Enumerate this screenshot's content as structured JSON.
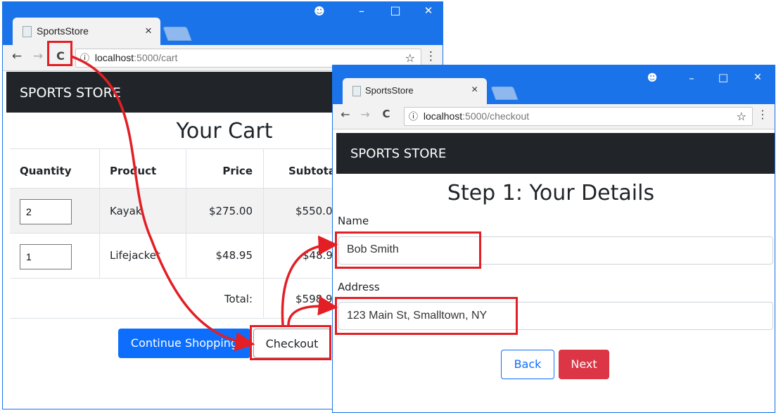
{
  "cart_window": {
    "tab_title": "SportsStore",
    "tab_close": "×",
    "url_host": "localhost",
    "url_path": ":5000/cart",
    "info_symbol": "ⓘ",
    "star": "☆",
    "menu": "⋮",
    "back": "←",
    "forward": "→",
    "reload": "C",
    "brand": "SPORTS STORE",
    "heading": "Your Cart",
    "table": {
      "headers": [
        "Quantity",
        "Product",
        "Price",
        "Subtotal"
      ],
      "rows": [
        {
          "quantity": "2",
          "product": "Kayak",
          "price": "$275.00",
          "subtotal": "$550.00"
        },
        {
          "quantity": "1",
          "product": "Lifejacket",
          "price": "$48.95",
          "subtotal": "$48.95"
        }
      ],
      "total_label": "Total:",
      "total_value": "$598.95"
    },
    "continue_button": "Continue Shopping",
    "checkout_button": "Checkout",
    "window_controls": {
      "account": "☻",
      "minimize": "–",
      "maximize": "□",
      "close": "✕"
    }
  },
  "checkout_window": {
    "tab_title": "SportsStore",
    "tab_close": "×",
    "url_host": "localhost",
    "url_path": ":5000/checkout",
    "info_symbol": "ⓘ",
    "star": "☆",
    "menu": "⋮",
    "back": "←",
    "forward": "→",
    "reload": "C",
    "brand": "SPORTS STORE",
    "heading": "Step 1: Your Details",
    "name_label": "Name",
    "name_value": "Bob Smith",
    "address_label": "Address",
    "address_value": "123 Main St, Smalltown, NY",
    "back_button": "Back",
    "next_button": "Next",
    "window_controls": {
      "account": "☻",
      "minimize": "–",
      "maximize": "□",
      "close": "✕"
    }
  },
  "colors": {
    "chrome_blue": "#1a73e8",
    "navbar": "#212529",
    "primary_button": "#0d6efd",
    "danger_button": "#dc3545",
    "annotation_red": "#e31e24"
  }
}
